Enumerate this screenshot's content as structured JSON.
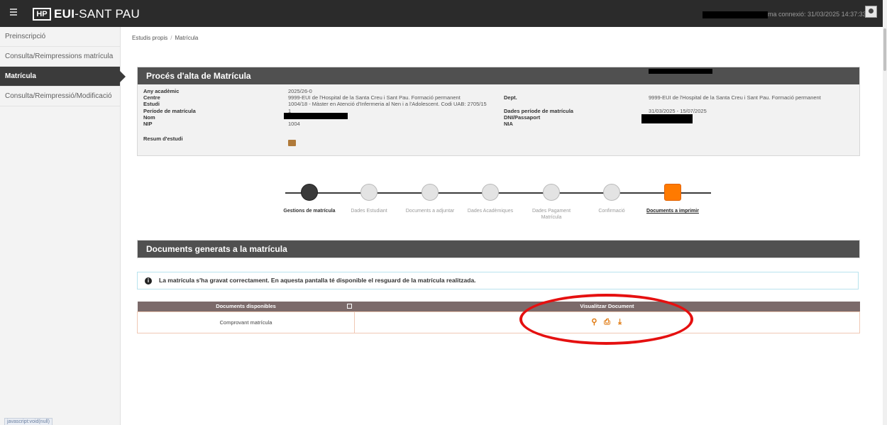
{
  "topbar": {
    "brand_mark": "HP",
    "brand_bold": "EUI",
    "brand_thin": "-SANT PAU",
    "connection": "ma connexió: 31/03/2025 14:37:33) ▾"
  },
  "sidebar": {
    "items": [
      {
        "label": "Preinscripció"
      },
      {
        "label": "Consulta/Reimpressions matrícula"
      },
      {
        "label": "Matrícula"
      },
      {
        "label": "Consulta/Reimpressió/Modificació"
      }
    ],
    "footer": "javascript:void(null)"
  },
  "breadcrumb": {
    "first": "Estudis propis",
    "separator": "/",
    "second": "Matrícula"
  },
  "proces": {
    "title": "Procés d'alta de Matrícula",
    "labels": {
      "any": "Any acadèmic",
      "centre": "Centre",
      "estudi": "Estudi",
      "periode": "Període de matrícula",
      "nom": "Nom",
      "nip": "NIP",
      "resum": "Resum d'estudi",
      "dept": "Dept.",
      "dades_periode": "Dades període de matrícula",
      "dni": "DNI/Passaport",
      "nia": "NIA"
    },
    "values": {
      "any": "2025/26-0",
      "centre": "9999-EUI de l'Hospital de la Santa Creu i Sant Pau. Formació permanent",
      "estudi": "1004/18 - Màster en Atenció d'Infermeria al Nen i a l'Adolescent. Codi UAB: 2705/15",
      "periode": "1",
      "nip": "1004",
      "dept": "9999-EUI de l'Hospital de la Santa Creu i Sant Pau. Formació permanent",
      "dades_periode": "31/03/2025 - 15/07/2025"
    }
  },
  "steps": [
    {
      "label": "Gestions de matrícula",
      "state": "done"
    },
    {
      "label": "Dades Estudiant",
      "state": "pending"
    },
    {
      "label": "Documents a adjuntar",
      "state": "pending"
    },
    {
      "label": "Dades Acadèmiques",
      "state": "pending"
    },
    {
      "label": "Dades Pagament Matrícula",
      "state": "pending"
    },
    {
      "label": "Confirmació",
      "state": "pending"
    },
    {
      "label": "Documents a imprimir",
      "state": "current"
    }
  ],
  "documents": {
    "title": "Documents generats a la matrícula",
    "alert": "La matrícula s'ha gravat correctament. En aquesta pantalla té disponible el resguard de la matrícula realitzada.",
    "columns": [
      "Documents disponibles",
      "Visualitzar Document"
    ],
    "rows": [
      {
        "name": "Comprovant matrícula",
        "actions": [
          "search-icon",
          "print-icon",
          "download-icon"
        ]
      }
    ]
  },
  "colors": {
    "header": "#505050",
    "accent_orange": "#ff7a00",
    "table_header": "#7b6a6a",
    "annotation": "#e51010"
  }
}
